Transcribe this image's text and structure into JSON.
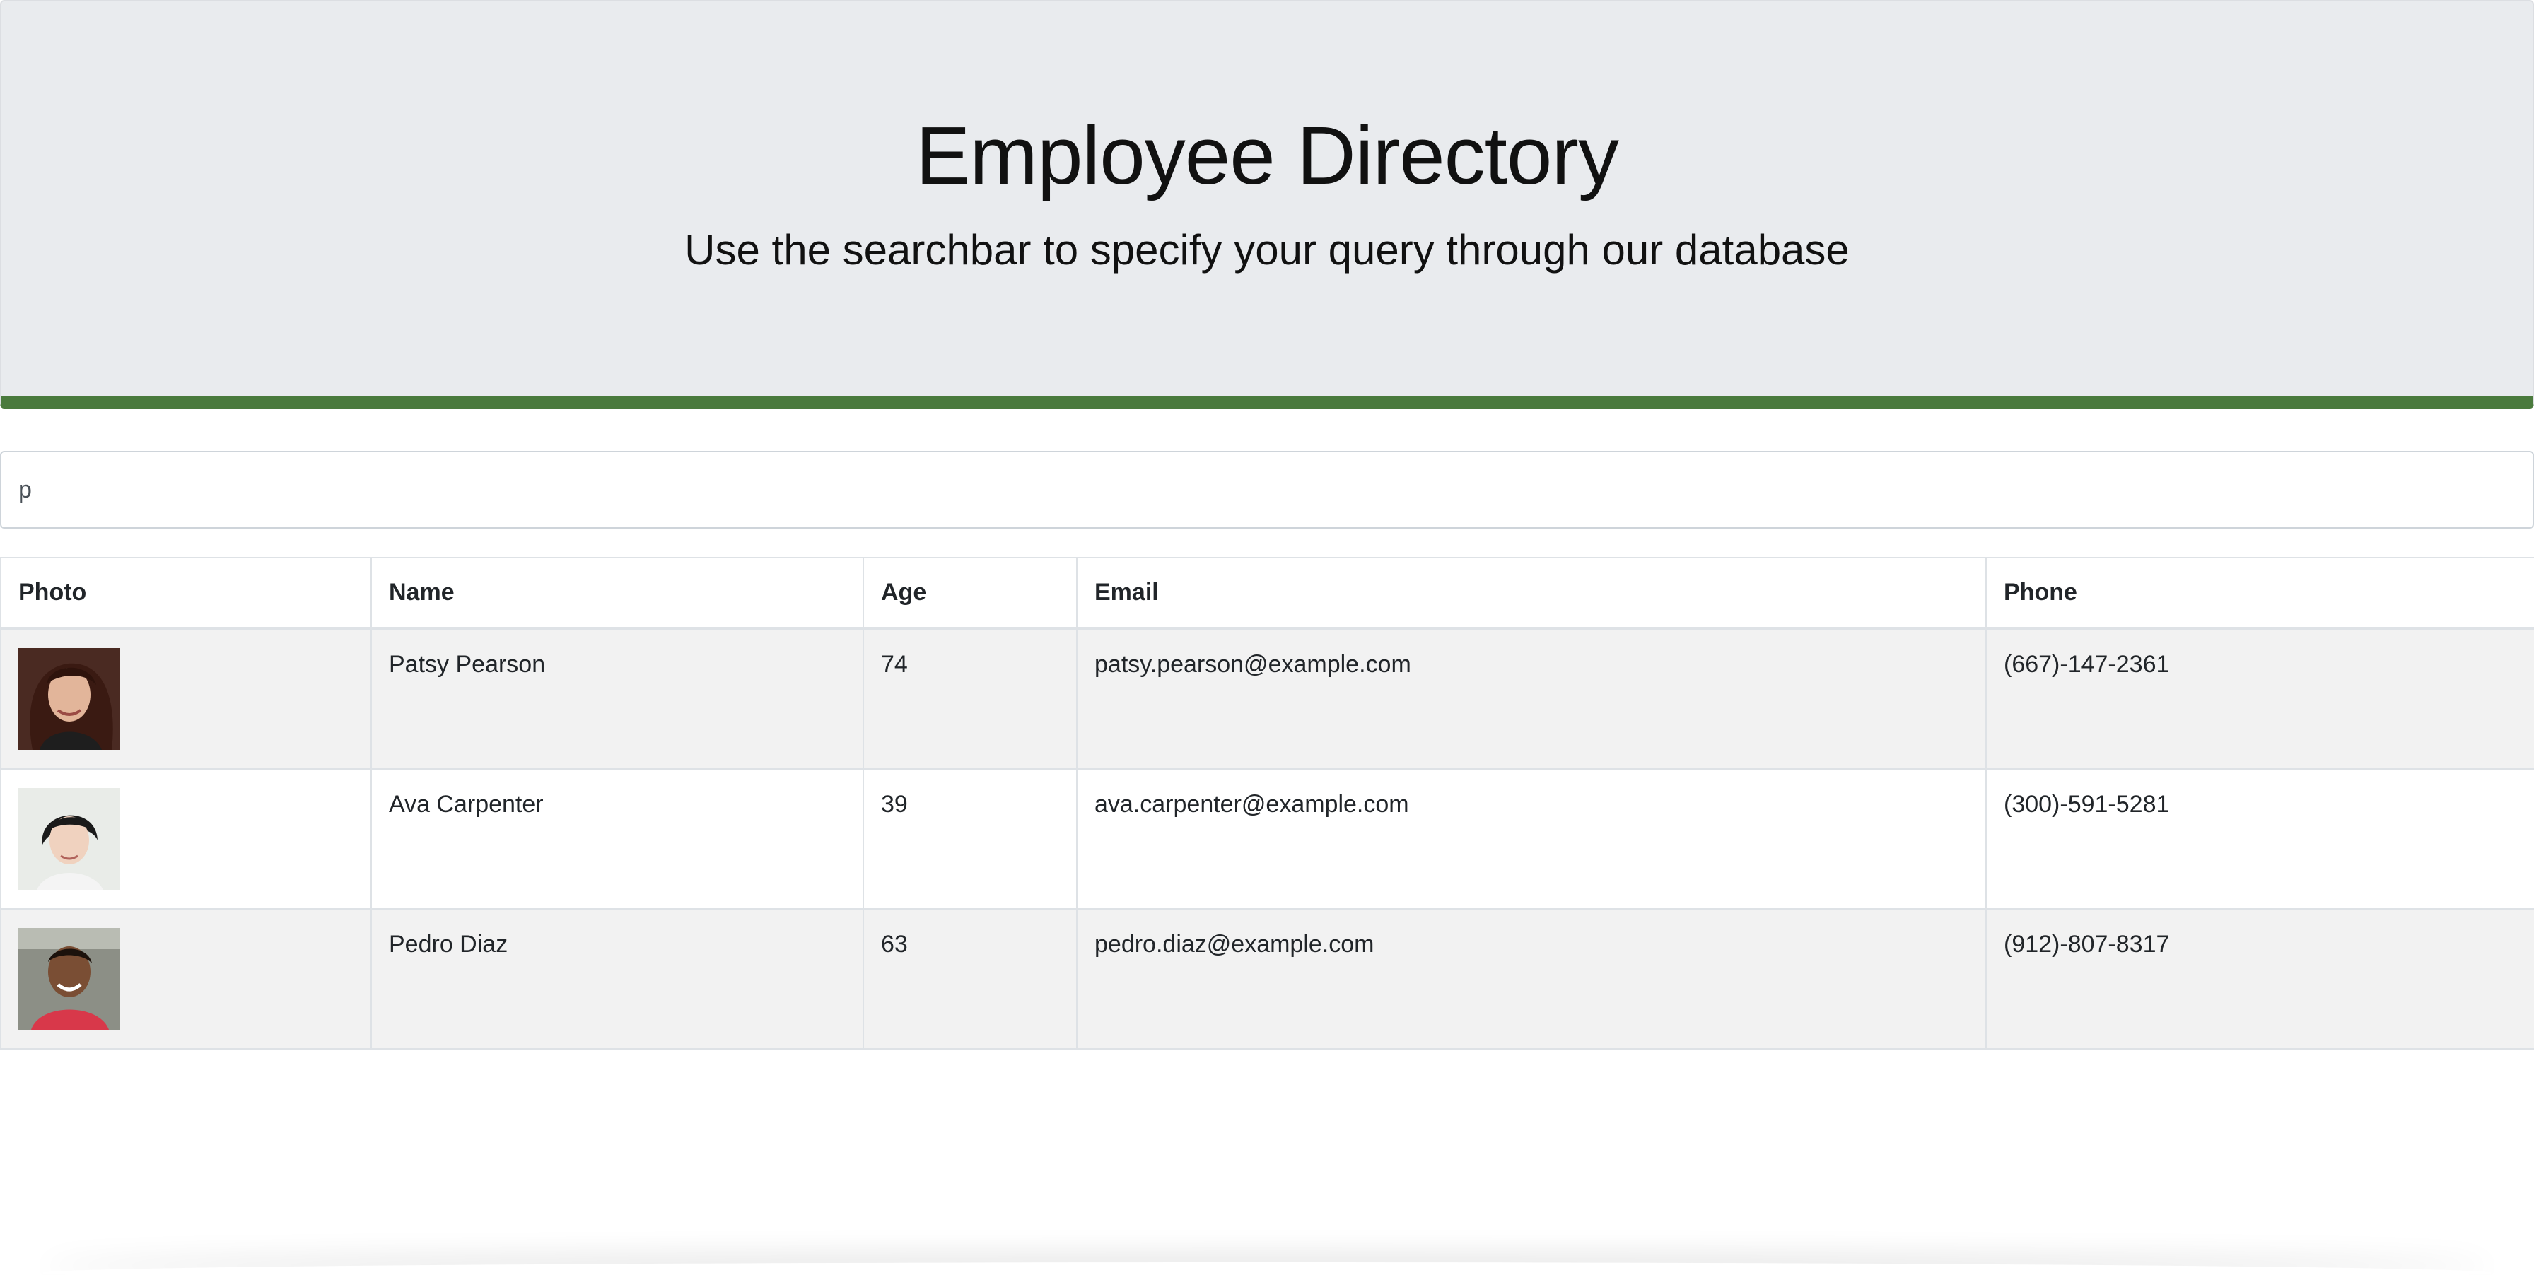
{
  "header": {
    "title": "Employee Directory",
    "subtitle": "Use the searchbar to specify your query through our database",
    "accent_color": "#4a7a3d"
  },
  "search": {
    "value": "p"
  },
  "table": {
    "columns": [
      "Photo",
      "Name",
      "Age",
      "Email",
      "Phone"
    ],
    "rows": [
      {
        "photo": "portrait-photo",
        "name": "Patsy Pearson",
        "age": "74",
        "email": "patsy.pearson@example.com",
        "phone": "(667)-147-2361"
      },
      {
        "photo": "portrait-photo",
        "name": "Ava Carpenter",
        "age": "39",
        "email": "ava.carpenter@example.com",
        "phone": "(300)-591-5281"
      },
      {
        "photo": "portrait-photo",
        "name": "Pedro Diaz",
        "age": "63",
        "email": "pedro.diaz@example.com",
        "phone": "(912)-807-8317"
      }
    ]
  }
}
